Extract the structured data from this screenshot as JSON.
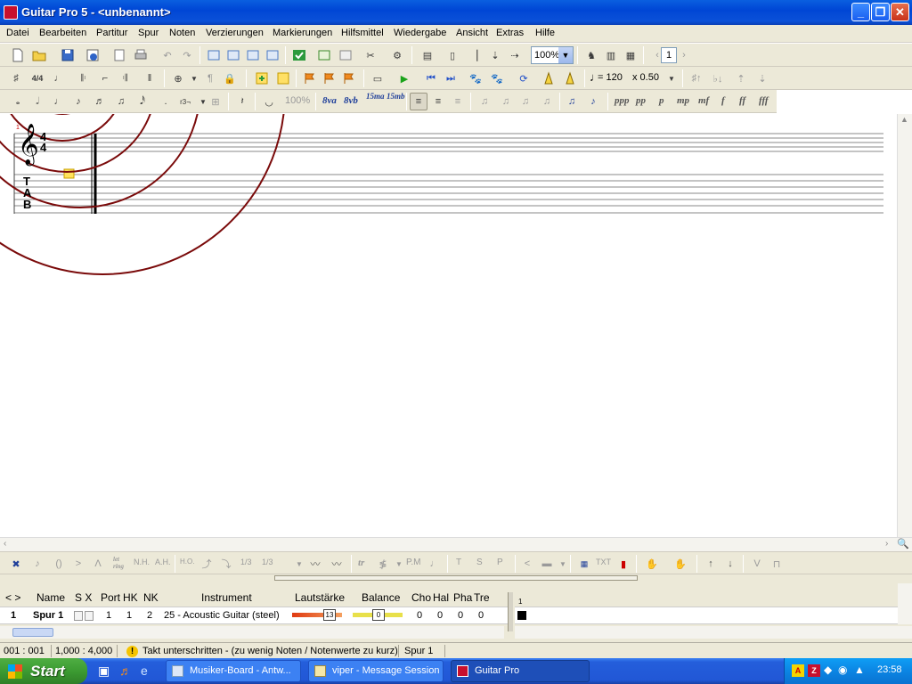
{
  "window": {
    "title": "Guitar Pro 5 - <unbenannt>"
  },
  "menu": [
    "Datei",
    "Bearbeiten",
    "Partitur",
    "Spur",
    "Noten",
    "Verzierungen",
    "Markierungen",
    "Hilfsmittel",
    "Wiedergabe",
    "Ansicht",
    "Extras",
    "Hilfe"
  ],
  "toolbar1": {
    "zoom": "100%",
    "page": "1"
  },
  "toolbar2": {
    "tempo": "= 120",
    "speed": "x 0.50"
  },
  "toolbar3": {
    "zoom_pct": "100%",
    "ottava": [
      "8va",
      "8vb",
      "15ma",
      "15mb"
    ],
    "dynamics": [
      "ppp",
      "pp",
      "p",
      "mp",
      "mf",
      "f",
      "ff",
      "fff"
    ]
  },
  "score": {
    "time_sig_top": "4",
    "time_sig_bottom": "4",
    "measure_number": "1",
    "tab_letters": [
      "T",
      "A",
      "B"
    ]
  },
  "bottom_toolbar": {
    "labels": [
      "let ring",
      "N.H.",
      "A.H.",
      "H.O.",
      "1/3",
      "1/3",
      "tr",
      "P.M",
      "T",
      "S",
      "P",
      "TXT"
    ]
  },
  "tracks": {
    "headers": {
      "nav": "< >",
      "name": "Name",
      "sx": "S X",
      "port": "Port",
      "hk": "HK",
      "nk": "NK",
      "instrument": "Instrument",
      "volume": "Lautstärke",
      "balance": "Balance",
      "cho": "Cho",
      "hal": "Hal",
      "pha": "Pha",
      "tre": "Tre"
    },
    "rows": [
      {
        "num": "1",
        "name": "Spur 1",
        "port": "1",
        "hk": "1",
        "nk": "2",
        "instrument": "25 - Acoustic Guitar (steel)",
        "volume": "13",
        "balance": "0",
        "cho": "0",
        "hal": "0",
        "pha": "0",
        "tre": "0"
      }
    ],
    "measure_header": "1"
  },
  "status": {
    "position": "001 : 001",
    "beats": "1,000 : 4,000",
    "message": "Takt unterschritten - (zu wenig Noten / Notenwerte zu kurz)",
    "track": "Spur 1"
  },
  "taskbar": {
    "start": "Start",
    "tasks": [
      "Musiker-Board - Antw...",
      "viper - Message Session",
      "Guitar Pro"
    ],
    "clock": "23:58"
  }
}
